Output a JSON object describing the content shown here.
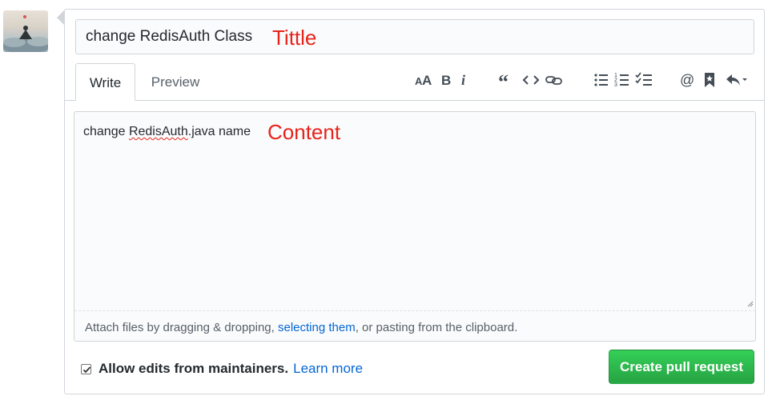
{
  "title_field": {
    "value": "change RedisAuth Class",
    "annotation": "Tittle"
  },
  "tabs": {
    "write": "Write",
    "preview": "Preview"
  },
  "toolbar": {
    "heading": "header-icon",
    "bold": "bold-icon",
    "italic": "italic-icon",
    "quote": "quote-icon",
    "code": "code-icon",
    "link": "link-icon",
    "bullet_list": "unordered-list-icon",
    "numbered_list": "ordered-list-icon",
    "task_list": "task-list-icon",
    "mention": "mention-icon",
    "saved_reply": "bookmark-icon",
    "reply": "reply-icon"
  },
  "editor": {
    "text_before": "change ",
    "text_misspelled": "RedisAuth",
    "text_after": ".java name",
    "annotation": "Content",
    "footer_prefix": "Attach files by dragging & dropping, ",
    "footer_link": "selecting them",
    "footer_suffix": ", or pasting from the clipboard."
  },
  "options": {
    "allow_edits_checked": true,
    "allow_edits_label": "Allow edits from maintainers.",
    "learn_more": "Learn more"
  },
  "submit": {
    "label": "Create pull request"
  },
  "colors": {
    "accent_green": "#28a745",
    "link_blue": "#0366d6",
    "annotation_red": "#e8231a"
  }
}
